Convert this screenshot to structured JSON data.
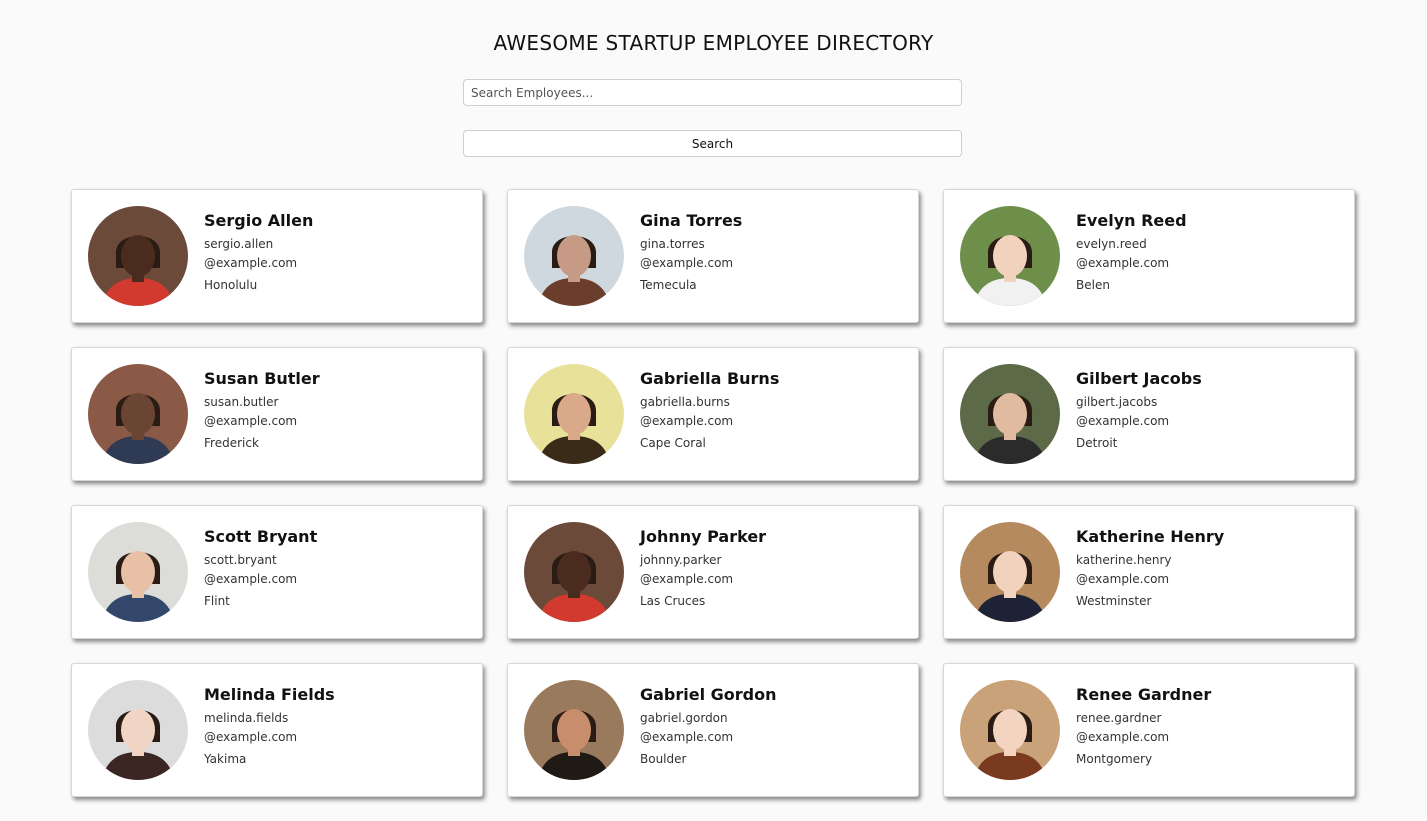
{
  "header": {
    "title": "AWESOME STARTUP EMPLOYEE DIRECTORY",
    "search_placeholder": "Search Employees...",
    "search_button_label": "Search"
  },
  "employees": [
    {
      "name": "Sergio Allen",
      "email_user": "sergio.allen",
      "email_domain": "@example.com",
      "city": "Honolulu",
      "avatar_icon": "person-photo-icon",
      "bg": "#6b4a3a",
      "skin": "#4a2c1f",
      "shirt": "#d23a2f"
    },
    {
      "name": "Gina Torres",
      "email_user": "gina.torres",
      "email_domain": "@example.com",
      "city": "Temecula",
      "avatar_icon": "person-photo-icon",
      "bg": "#cfd8de",
      "skin": "#c69a85",
      "shirt": "#6a3d2c"
    },
    {
      "name": "Evelyn Reed",
      "email_user": "evelyn.reed",
      "email_domain": "@example.com",
      "city": "Belen",
      "avatar_icon": "person-photo-icon",
      "bg": "#6d8f4a",
      "skin": "#f0d2bd",
      "shirt": "#f1f1f1"
    },
    {
      "name": "Susan Butler",
      "email_user": "susan.butler",
      "email_domain": "@example.com",
      "city": "Frederick",
      "avatar_icon": "person-photo-icon",
      "bg": "#8a5a47",
      "skin": "#6b4533",
      "shirt": "#2f3a55"
    },
    {
      "name": "Gabriella Burns",
      "email_user": "gabriella.burns",
      "email_domain": "@example.com",
      "city": "Cape Coral",
      "avatar_icon": "person-photo-icon",
      "bg": "#e8e19a",
      "skin": "#d9a98a",
      "shirt": "#3a2a18"
    },
    {
      "name": "Gilbert Jacobs",
      "email_user": "gilbert.jacobs",
      "email_domain": "@example.com",
      "city": "Detroit",
      "avatar_icon": "person-photo-icon",
      "bg": "#5c6a48",
      "skin": "#e0bba0",
      "shirt": "#2b2b2b"
    },
    {
      "name": "Scott Bryant",
      "email_user": "scott.bryant",
      "email_domain": "@example.com",
      "city": "Flint",
      "avatar_icon": "person-photo-icon",
      "bg": "#dcdcd8",
      "skin": "#e7c0a6",
      "shirt": "#33476b"
    },
    {
      "name": "Johnny Parker",
      "email_user": "johnny.parker",
      "email_domain": "@example.com",
      "city": "Las Cruces",
      "avatar_icon": "person-photo-icon",
      "bg": "#6b4a3a",
      "skin": "#4a2c1f",
      "shirt": "#d23a2f"
    },
    {
      "name": "Katherine Henry",
      "email_user": "katherine.henry",
      "email_domain": "@example.com",
      "city": "Westminster",
      "avatar_icon": "person-photo-icon",
      "bg": "#b58a5e",
      "skin": "#f1d2bd",
      "shirt": "#1d2236"
    },
    {
      "name": "Melinda Fields",
      "email_user": "melinda.fields",
      "email_domain": "@example.com",
      "city": "Yakima",
      "avatar_icon": "person-photo-icon",
      "bg": "#dcdcdc",
      "skin": "#f0d4c4",
      "shirt": "#3a2622"
    },
    {
      "name": "Gabriel Gordon",
      "email_user": "gabriel.gordon",
      "email_domain": "@example.com",
      "city": "Boulder",
      "avatar_icon": "person-photo-icon",
      "bg": "#9a7a5c",
      "skin": "#c88e6b",
      "shirt": "#1f1a16"
    },
    {
      "name": "Renee Gardner",
      "email_user": "renee.gardner",
      "email_domain": "@example.com",
      "city": "Montgomery",
      "avatar_icon": "person-photo-icon",
      "bg": "#c9a27a",
      "skin": "#f2d4c0",
      "shirt": "#7a3a20"
    }
  ]
}
